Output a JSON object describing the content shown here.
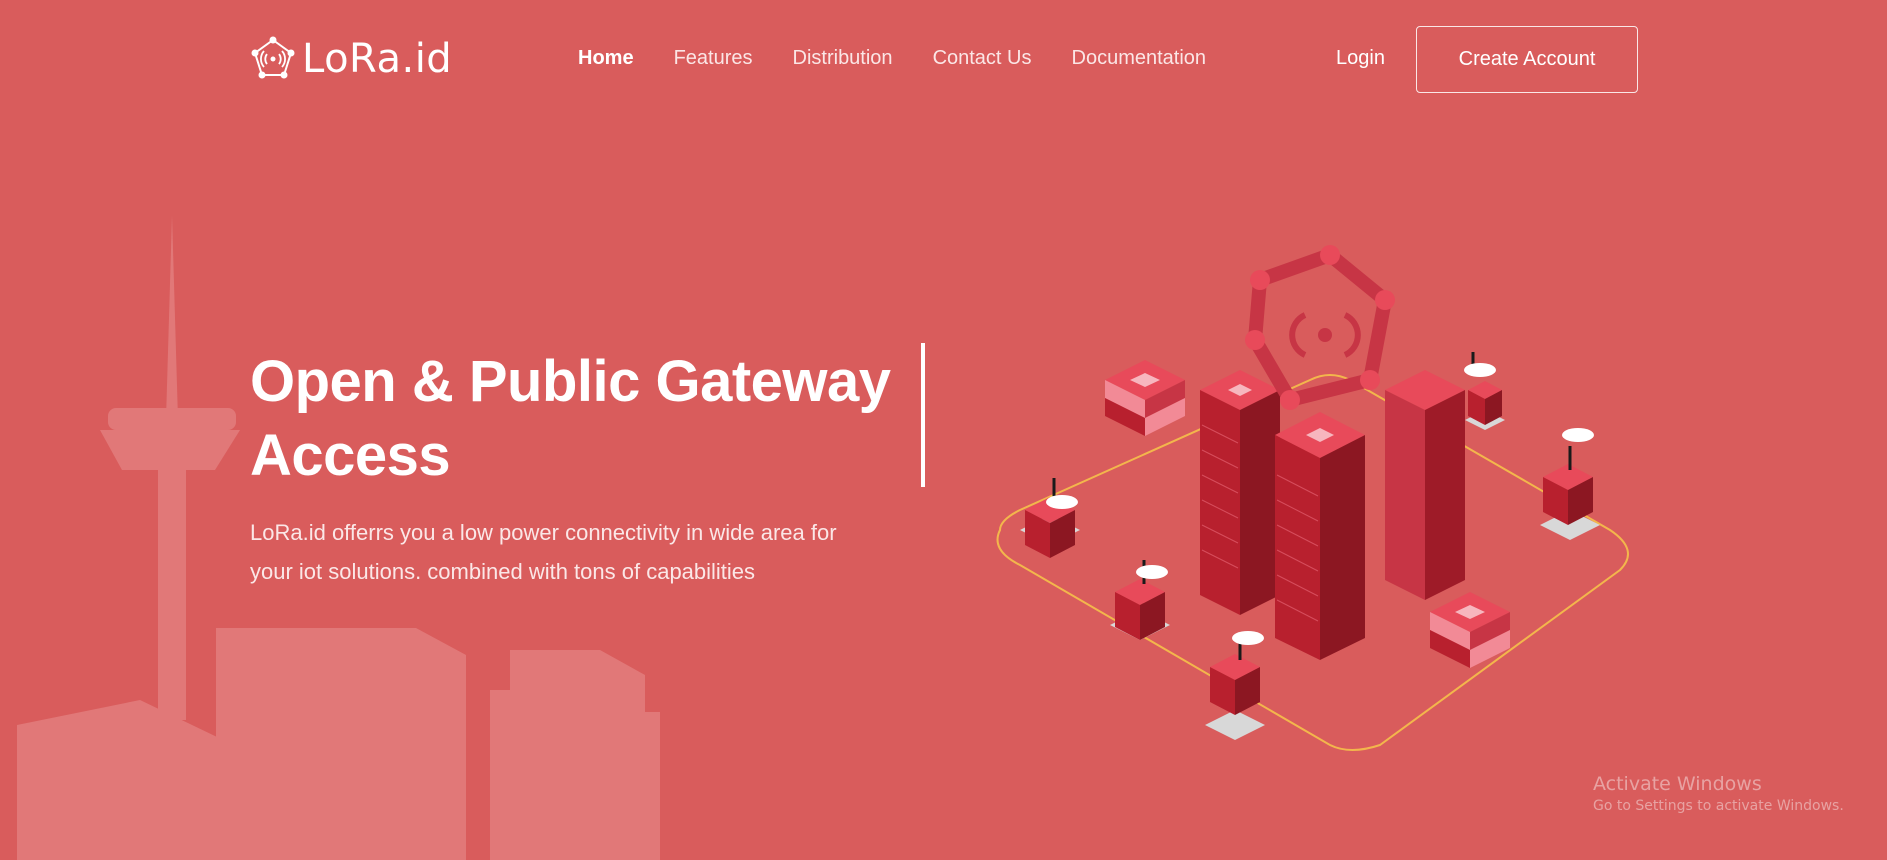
{
  "brand": {
    "name": "LoRa.id",
    "icon": "lora-signal-logo-icon"
  },
  "nav": {
    "items": [
      {
        "label": "Home",
        "active": true
      },
      {
        "label": "Features",
        "active": false
      },
      {
        "label": "Distribution",
        "active": false
      },
      {
        "label": "Contact Us",
        "active": false
      },
      {
        "label": "Documentation",
        "active": false
      }
    ],
    "login_label": "Login",
    "create_account_label": "Create Account"
  },
  "hero": {
    "title_line1": "Open & Public Gateway",
    "title_line2": "Access",
    "subtitle_line1": "LoRa.id offerrs you a low power connectivity in wide area for",
    "subtitle_line2": "your iot solutions. combined with tons of capabilities"
  },
  "watermark": {
    "title": "Activate Windows",
    "subtitle": "Go to Settings to activate Windows."
  },
  "colors": {
    "background": "#d95c5c",
    "server_dark": "#b8202e",
    "server_light": "#e84a5a",
    "connection_line": "#f5c04a"
  }
}
